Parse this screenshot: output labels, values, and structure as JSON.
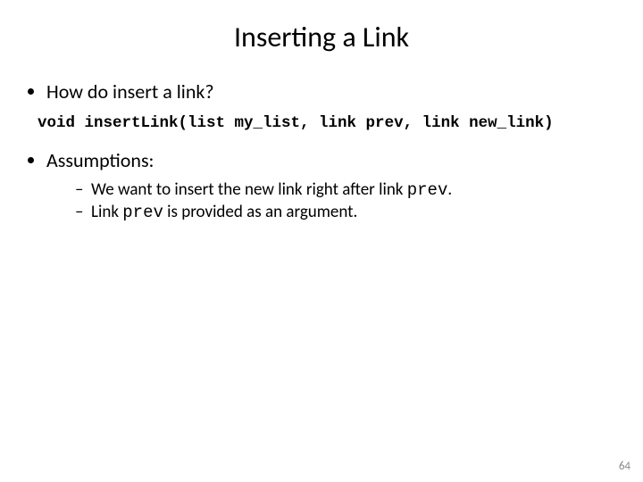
{
  "title": "Inserting a Link",
  "bullets": {
    "q": "How do insert a link?",
    "code": "void insertLink(list my_list, link prev, link new_link)",
    "assumptionsLabel": "Assumptions:",
    "sub": {
      "a_pre": "We want to insert the new link right after link ",
      "a_code": "prev",
      "a_post": ".",
      "b_pre": "Link ",
      "b_code": "prev",
      "b_post": " is provided as an argument."
    }
  },
  "pageNumber": "64"
}
